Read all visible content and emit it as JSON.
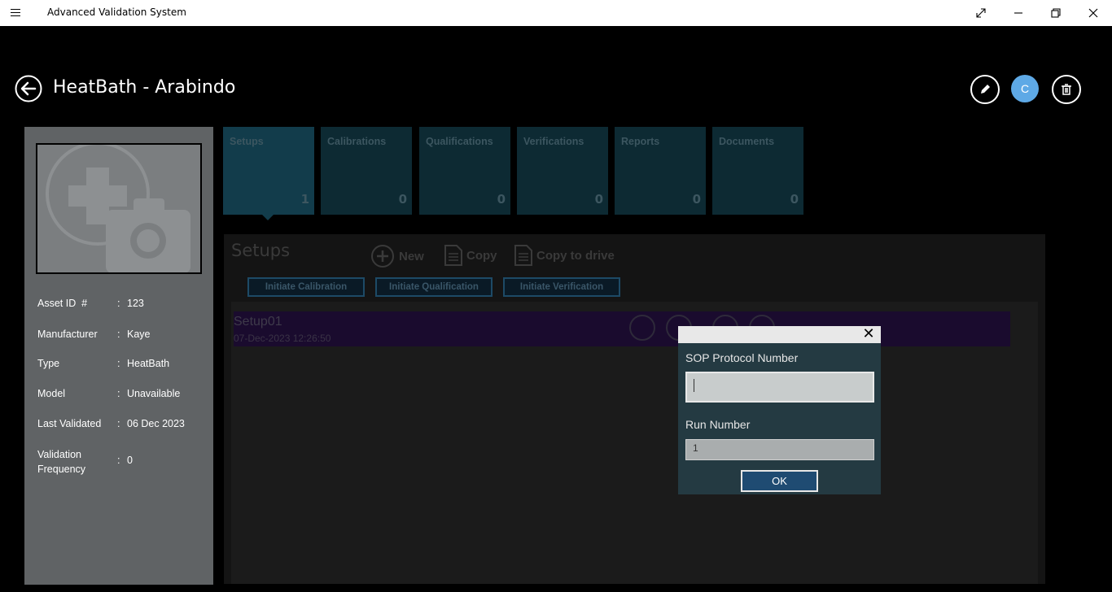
{
  "window": {
    "title": "Advanced Validation System"
  },
  "header": {
    "title": "HeatBath - Arabindo",
    "avatar_initial": "C"
  },
  "asset": {
    "rows": [
      {
        "label": "Asset ID  #",
        "value": "123"
      },
      {
        "label": "Manufacturer",
        "value": "Kaye"
      },
      {
        "label": "Type",
        "value": "HeatBath"
      },
      {
        "label": "Model",
        "value": "Unavailable"
      },
      {
        "label": "Last Validated",
        "value": "06 Dec 2023"
      },
      {
        "label": "Validation Frequency",
        "value": "0"
      }
    ],
    "colon": ":"
  },
  "tabs": [
    {
      "label": "Setups",
      "count": "1"
    },
    {
      "label": "Calibrations",
      "count": "0"
    },
    {
      "label": "Qualifications",
      "count": "0"
    },
    {
      "label": "Verifications",
      "count": "0"
    },
    {
      "label": "Reports",
      "count": "0"
    },
    {
      "label": "Documents",
      "count": "0"
    }
  ],
  "content": {
    "title": "Setups",
    "toolbar": {
      "new_label": "New",
      "copy_label": "Copy",
      "copy_drive_label": "Copy to drive"
    },
    "buttons": {
      "calibration": "Initiate Calibration",
      "qualification": "Initiate Qualification",
      "verification": "Initiate Verification"
    },
    "setups": [
      {
        "name": "Setup01",
        "date": "07-Dec-2023 12:26:50"
      }
    ]
  },
  "dialog": {
    "close_glyph": "✕",
    "sop_label": "SOP Protocol Number",
    "sop_value": "",
    "run_label": "Run Number",
    "run_value": "1",
    "ok_label": "OK"
  },
  "colors": {
    "accent": "#5ea9e6",
    "tile_bg": "#0d2a33",
    "dialog_bg": "#243a42",
    "ok_button": "#1f4b72"
  }
}
